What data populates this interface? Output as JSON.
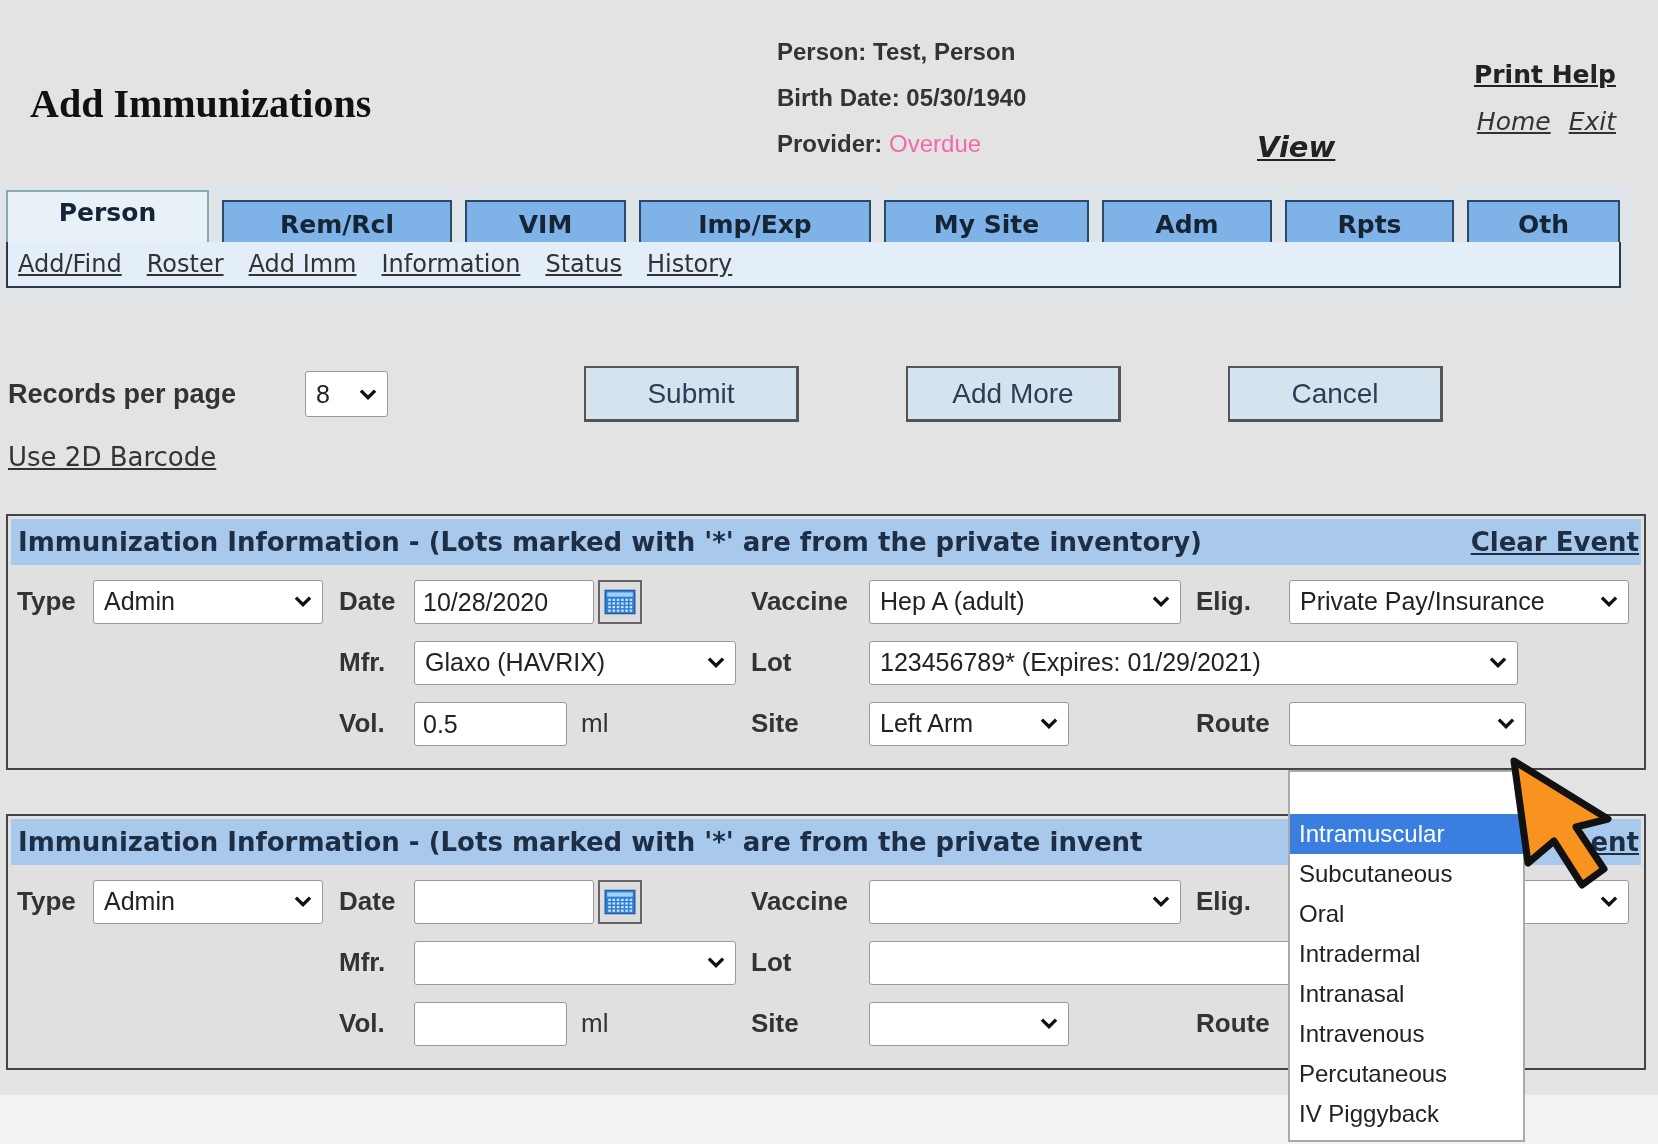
{
  "page_title": "Add Immunizations",
  "patient": {
    "person": "Person: Test, Person",
    "birth_date": "Birth Date: 05/30/1940",
    "provider_label": "Provider:",
    "provider_status": "Overdue"
  },
  "view_link": "View",
  "print_help_link": "Print Help",
  "home_link": "Home",
  "exit_link": "Exit",
  "tabs": [
    {
      "label": "Person",
      "selected": true
    },
    {
      "label": "Rem/Rcl",
      "selected": false
    },
    {
      "label": "VIM",
      "selected": false
    },
    {
      "label": "Imp/Exp",
      "selected": false
    },
    {
      "label": "My Site",
      "selected": false
    },
    {
      "label": "Adm",
      "selected": false
    },
    {
      "label": "Rpts",
      "selected": false
    },
    {
      "label": "Oth",
      "selected": false
    }
  ],
  "subnav": [
    "Add/Find",
    "Roster",
    "Add Imm",
    "Information",
    "Status",
    "History"
  ],
  "records_per_page": {
    "label": "Records per page",
    "value": "8"
  },
  "buttons": [
    "Submit",
    "Add More",
    "Cancel"
  ],
  "barcode_link": "Use 2D Barcode",
  "sections": [
    {
      "title": "Immunization Information - (Lots marked with '*' are from the private inventory)",
      "clear_event": "Clear Event",
      "labels": {
        "type": "Type",
        "date": "Date",
        "vaccine": "Vaccine",
        "elig": "Elig.",
        "mfr": "Mfr.",
        "lot": "Lot",
        "vol": "Vol.",
        "unit": "ml",
        "site": "Site",
        "route": "Route"
      },
      "type": "Admin",
      "date": "10/28/2020",
      "vaccine": "Hep A (adult)",
      "elig": "Private Pay/Insurance",
      "mfr": "Glaxo (HAVRIX)",
      "lot": "123456789* (Expires: 01/29/2021)",
      "vol": "0.5",
      "site": "Left Arm",
      "route_field": {
        "open": true,
        "options": [
          {
            "label": "Intramuscular",
            "selected": true
          },
          {
            "label": "Subcutaneous",
            "selected": false
          },
          {
            "label": "Oral",
            "selected": false
          },
          {
            "label": "Intradermal",
            "selected": false
          },
          {
            "label": "Intranasal",
            "selected": false
          },
          {
            "label": "Intravenous",
            "selected": false
          },
          {
            "label": "Percutaneous",
            "selected": false
          },
          {
            "label": "IV Piggyback",
            "selected": false
          }
        ]
      }
    },
    {
      "title": "Immunization Information - (Lots marked with '*' are from the private invent",
      "clear_event": "ent",
      "labels": {
        "type": "Type",
        "date": "Date",
        "vaccine": "Vaccine",
        "elig": "Elig.",
        "mfr": "Mfr.",
        "lot": "Lot",
        "vol": "Vol.",
        "unit": "ml",
        "site": "Site",
        "route": "Route"
      },
      "type": "Admin"
    }
  ]
}
